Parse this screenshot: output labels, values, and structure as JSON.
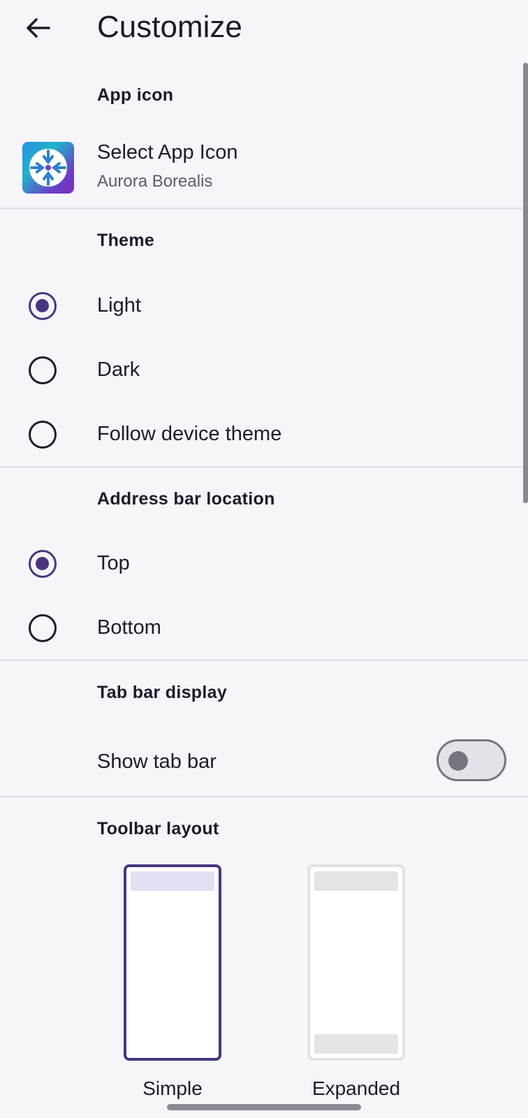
{
  "header": {
    "title": "Customize",
    "back_icon": "arrow-left-icon"
  },
  "sections": {
    "app_icon": {
      "header": "App icon",
      "item_label": "Select App Icon",
      "item_value": "Aurora Borealis",
      "icon": "aurora-borealis-app-icon"
    },
    "theme": {
      "header": "Theme",
      "options": [
        {
          "label": "Light",
          "selected": true
        },
        {
          "label": "Dark",
          "selected": false
        },
        {
          "label": "Follow device theme",
          "selected": false
        }
      ]
    },
    "address_bar": {
      "header": "Address bar location",
      "options": [
        {
          "label": "Top",
          "selected": true
        },
        {
          "label": "Bottom",
          "selected": false
        }
      ]
    },
    "tab_bar": {
      "header": "Tab bar display",
      "toggle_label": "Show tab bar",
      "toggle_on": false
    },
    "toolbar": {
      "header": "Toolbar layout",
      "options": [
        {
          "label": "Simple",
          "selected": true
        },
        {
          "label": "Expanded",
          "selected": false
        }
      ]
    }
  },
  "colors": {
    "accent": "#4a347f",
    "background": "#f6f5fa",
    "text": "#1d1b26",
    "divider": "#dedce3"
  }
}
